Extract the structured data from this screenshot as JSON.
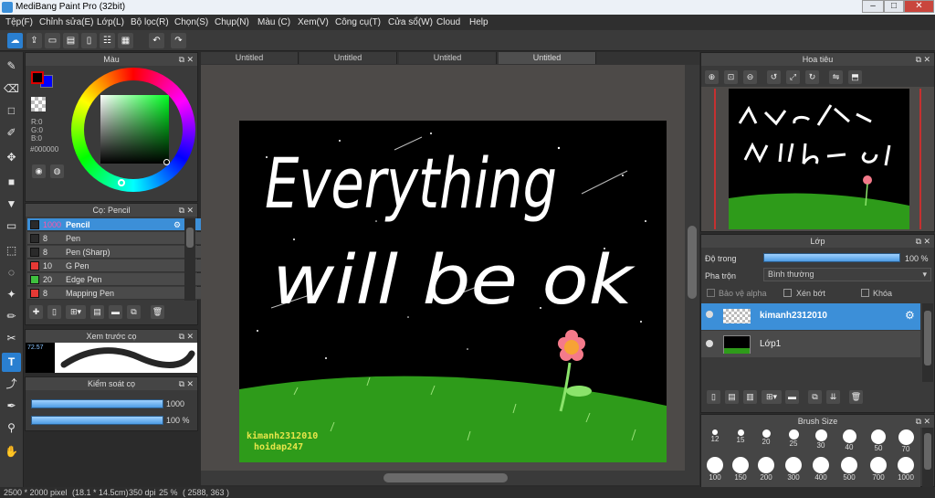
{
  "window": {
    "title": "MediBang Paint Pro (32bit)",
    "minimize": "–",
    "maximize": "□",
    "close": "✕"
  },
  "menu": [
    "Tệp(F)",
    "Chỉnh sửa(E)",
    "Lớp(L)",
    "Bộ lọc(R)",
    "Chọn(S)",
    "Chụp(N)",
    "Màu (C)",
    "Xem(V)",
    "Công cụ(T)",
    "Cửa sổ(W)",
    "Cloud",
    "Help"
  ],
  "toolbar_icons": [
    "cloud-icon",
    "share-icon",
    "comment-icon",
    "comment-edit-icon",
    "page-icon",
    "page-list-icon",
    "grid-icon",
    "undo-icon",
    "redo-icon"
  ],
  "color_panel": {
    "title": "Màu",
    "r": "R:0",
    "g": "G:0",
    "b": "B:0",
    "hex": "#000000",
    "fg": "#000000",
    "bg": "#0000ff"
  },
  "brush_panel": {
    "title": "Cọ: Pencil",
    "items": [
      {
        "size": "1000",
        "name": "Pencil",
        "color": "#2a2a2a",
        "active": true
      },
      {
        "size": "8",
        "name": "Pen",
        "color": "#2a2a2a"
      },
      {
        "size": "8",
        "name": "Pen (Sharp)",
        "color": "#2a2a2a"
      },
      {
        "size": "10",
        "name": "G Pen",
        "color": "#e53935"
      },
      {
        "size": "20",
        "name": "Edge Pen",
        "color": "#3fbf3f"
      },
      {
        "size": "8",
        "name": "Mapping Pen",
        "color": "#e53935"
      }
    ]
  },
  "preview_panel": {
    "title": "Xem trước cọ",
    "value": "72.57"
  },
  "control_panel": {
    "title": "Kiểm soát cọ",
    "size": "1000",
    "opacity": "100 %"
  },
  "tabs": [
    "Untitled",
    "Untitled",
    "Untitled",
    "Untitled"
  ],
  "artwork": {
    "line1": "Everything",
    "line2": "will be ok",
    "credit1": "kimanh2312010",
    "credit2": "hoidap247"
  },
  "navigator": {
    "title": "Hoa tiêu"
  },
  "layer_panel": {
    "title": "Lớp",
    "opacity_label": "Độ trong",
    "opacity_value": "100 %",
    "blend_label": "Pha trộn",
    "blend_value": "Bình thường",
    "alpha_label": "Bảo vệ alpha",
    "clip_label": "Xén bớt",
    "lock_label": "Khóa",
    "layers": [
      {
        "name": "kimanh2312010",
        "selected": true
      },
      {
        "name": "Lớp1",
        "selected": false
      }
    ]
  },
  "brush_size": {
    "title": "Brush Size",
    "row1": [
      "12",
      "15",
      "20",
      "25",
      "30",
      "40",
      "50",
      "70"
    ],
    "row2": [
      "100",
      "150",
      "200",
      "300",
      "400",
      "500",
      "700",
      "1000"
    ]
  },
  "status": {
    "dims": "2500 * 2000 pixel",
    "phys": "(18.1 * 14.5cm)",
    "dpi": "350 dpi",
    "zoom": "25 %",
    "coords": "( 2588, 363 )"
  }
}
